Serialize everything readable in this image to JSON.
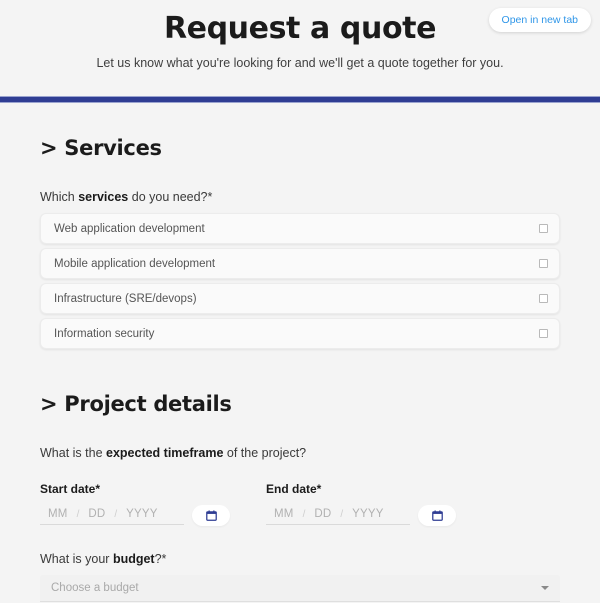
{
  "header": {
    "title": "Request a quote",
    "subtitle": "Let us know what you're looking for and we'll get a quote together for you.",
    "open_new_tab_label": "Open in new tab",
    "accent_color": "#2f3d93",
    "link_color": "#2f96e8",
    "background_color": "#f4f4f4"
  },
  "services_section": {
    "heading": "> Services",
    "question_prefix": "Which ",
    "question_bold": "services",
    "question_suffix": " do you need?*",
    "options": [
      {
        "label": "Web application development",
        "checked": false
      },
      {
        "label": "Mobile application development",
        "checked": false
      },
      {
        "label": "Infrastructure (SRE/devops)",
        "checked": false
      },
      {
        "label": "Information security",
        "checked": false
      }
    ]
  },
  "project_section": {
    "heading": "> Project details",
    "timeframe_prefix": "What is the ",
    "timeframe_bold": "expected timeframe",
    "timeframe_suffix": " of the project?",
    "start_date": {
      "label": "Start date*",
      "month_placeholder": "MM",
      "day_placeholder": "DD",
      "year_placeholder": "YYYY",
      "separator": "/",
      "value": ""
    },
    "end_date": {
      "label": "End date*",
      "month_placeholder": "MM",
      "day_placeholder": "DD",
      "year_placeholder": "YYYY",
      "separator": "/",
      "value": ""
    },
    "budget_prefix": "What is your ",
    "budget_bold": "budget",
    "budget_suffix": "?*",
    "budget_placeholder": "Choose a budget",
    "budget_value": ""
  }
}
